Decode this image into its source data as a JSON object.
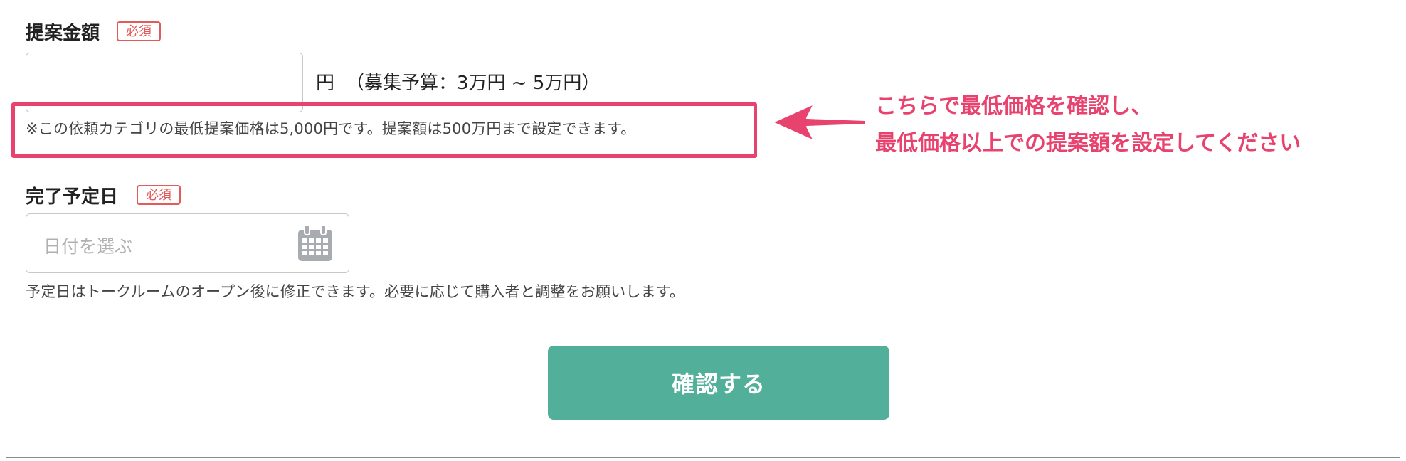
{
  "amount_field": {
    "label": "提案金額",
    "required_badge": "必須",
    "value": "",
    "unit": "円",
    "budget_note": "（募集予算：3万円 ~ 5万円）",
    "min_price_note": "※この依頼カテゴリの最低提案価格は5,000円です。提案額は500万円まで設定できます。"
  },
  "annotation": {
    "line1": "こちらで最低価格を確認し、",
    "line2": "最低価格以上での提案額を設定してください",
    "arrow_icon": "left-arrow-icon"
  },
  "due_date_field": {
    "label": "完了予定日",
    "required_badge": "必須",
    "placeholder": "日付を選ぶ",
    "icon": "calendar-icon",
    "help_text": "予定日はトークルームのオープン後に修正できます。必要に応じて購入者と調整をお願いします。"
  },
  "confirm_button": {
    "label": "確認する"
  },
  "colors": {
    "accent_pink": "#e8436e",
    "required_red": "#e45a5a",
    "button_green": "#52b09a",
    "icon_gray": "#a8acb0"
  }
}
